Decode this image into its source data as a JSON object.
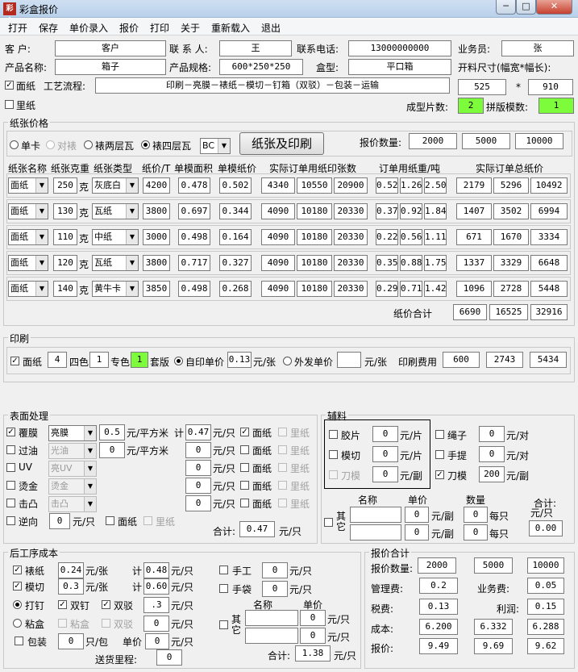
{
  "window": {
    "title": "彩盒报价",
    "app_icon": "彩盒",
    "controls": [
      "─",
      "□",
      "✕"
    ]
  },
  "menu": [
    "打开",
    "保存",
    "单价录入",
    "报价",
    "打印",
    "关于",
    "重新载入",
    "退出"
  ],
  "header": {
    "customer_label": "客    户:",
    "customer": "客户",
    "contact_label": "联 系 人:",
    "contact": "王",
    "phone_label": "联系电话:",
    "phone": "13000000000",
    "sales_label": "业务员:",
    "sales": "张",
    "product_label": "产品名称:",
    "product": "箱子",
    "spec_label": "产品规格:",
    "spec": "600*250*250",
    "boxtype_label": "盒型:",
    "boxtype": "平口箱",
    "opensize_label": "开料尺寸(幅宽*幅长):",
    "facepaper_label": "面纸",
    "process_label": "工艺流程:",
    "process": "印刷－亮膜－裱纸－模切－钉箱（双驳）－包装－运输",
    "w": "525",
    "star": "*",
    "h": "910",
    "inner_label": "里纸",
    "pieces_label": "成型片数:",
    "pieces": "2",
    "imposition_label": "拼版模数:",
    "imposition": "1"
  },
  "paper": {
    "group_title": "纸张价格",
    "radio": [
      "单卡",
      "对裱",
      "裱两层瓦",
      "裱四层瓦"
    ],
    "flute": "BC",
    "button": "纸张及印刷",
    "qty_label": "报价数量:",
    "qty": [
      "2000",
      "5000",
      "10000"
    ],
    "headers": [
      "纸张名称",
      "纸张克重",
      "纸张类型",
      "纸价/T",
      "单模面积",
      "单模纸价",
      "实际订单用纸印张数",
      "订单用纸重/吨",
      "实际订单总纸价"
    ],
    "unit": "克",
    "rows": [
      {
        "name": "面纸",
        "gsm": "250",
        "type": "灰底白",
        "price": "4200",
        "area": "0.478",
        "uprice": "0.502",
        "sheets": [
          "4340",
          "10550",
          "20900"
        ],
        "weight": [
          "0.52",
          "1.26",
          "2.50"
        ],
        "total": [
          "2179",
          "5296",
          "10492"
        ]
      },
      {
        "name": "面纸",
        "gsm": "130",
        "type": "瓦纸",
        "price": "3800",
        "area": "0.697",
        "uprice": "0.344",
        "sheets": [
          "4090",
          "10180",
          "20330"
        ],
        "weight": [
          "0.37",
          "0.92",
          "1.84"
        ],
        "total": [
          "1407",
          "3502",
          "6994"
        ]
      },
      {
        "name": "面纸",
        "gsm": "110",
        "type": "中纸",
        "price": "3000",
        "area": "0.498",
        "uprice": "0.164",
        "sheets": [
          "4090",
          "10180",
          "20330"
        ],
        "weight": [
          "0.22",
          "0.56",
          "1.11"
        ],
        "total": [
          "671",
          "1670",
          "3334"
        ]
      },
      {
        "name": "面纸",
        "gsm": "120",
        "type": "瓦纸",
        "price": "3800",
        "area": "0.717",
        "uprice": "0.327",
        "sheets": [
          "4090",
          "10180",
          "20330"
        ],
        "weight": [
          "0.35",
          "0.88",
          "1.75"
        ],
        "total": [
          "1337",
          "3329",
          "6648"
        ]
      },
      {
        "name": "面纸",
        "gsm": "140",
        "type": "黄牛卡",
        "price": "3850",
        "area": "0.498",
        "uprice": "0.268",
        "sheets": [
          "4090",
          "10180",
          "20330"
        ],
        "weight": [
          "0.29",
          "0.71",
          "1.42"
        ],
        "total": [
          "1096",
          "2728",
          "5448"
        ]
      }
    ],
    "sum_label": "纸价合计",
    "sum": [
      "6690",
      "16525",
      "32916"
    ]
  },
  "print": {
    "group_title": "印刷",
    "face_label": "面纸",
    "four": "4",
    "four_label": "四色",
    "spot": "1",
    "spot_label": "专色",
    "set": "1",
    "set_label": "套版",
    "self_label": "自印单价",
    "self": "0.13",
    "unit1": "元/张",
    "out_label": "外发单价",
    "out": "",
    "unit2": "元/张",
    "fee_label": "印刷费用",
    "fee": [
      "600",
      "2743",
      "5434"
    ]
  },
  "surface": {
    "group_title": "表面处理",
    "unit_sqm": "元/平方米",
    "ji": "计",
    "unit_pc": "元/只",
    "face": "面纸",
    "inner": "里纸",
    "rows": [
      {
        "label": "覆膜",
        "sel": "亮膜",
        "v1": "0.5",
        "v2": "0.47"
      },
      {
        "label": "过油",
        "sel": "光油",
        "v1": "0",
        "v2": "0"
      },
      {
        "label": "UV",
        "sel": "亮UV",
        "v2": "0"
      },
      {
        "label": "烫金",
        "sel": "烫金",
        "v2": "0"
      },
      {
        "label": "击凸",
        "sel": "击凸",
        "v2": "0"
      }
    ],
    "reverse_label": "逆向",
    "reverse": "0",
    "total_label": "合计:",
    "total": "0.47"
  },
  "aux": {
    "group_title": "辅料",
    "window_label": "胶片",
    "window": "0",
    "window_unit": "元/片",
    "die_label": "模切",
    "die": "0",
    "die_unit": "元/片",
    "knife_label": "刀模",
    "knife": "0",
    "knife_unit": "元/副",
    "rope_label": "绳子",
    "rope": "0",
    "rope_unit": "元/对",
    "handle_label": "手提",
    "handle": "0",
    "handle_unit": "元/对",
    "blade_label": "刀模",
    "blade": "200",
    "blade_unit": "元/副",
    "name_h": "名称",
    "price_h": "单价",
    "qty_h": "数量",
    "other_label": "其它",
    "other_unit": "元/副",
    "each": "每只",
    "p1": "0",
    "p2": "0",
    "q1": "0",
    "q2": "0",
    "total_label": "合计:\n元/只",
    "total_label1": "合计:",
    "total_label2": "元/只",
    "total": "0.00"
  },
  "post": {
    "group_title": "后工序成本",
    "mount_label": "裱纸",
    "mount": "0.24",
    "mount_unit": "元/张",
    "ji": "计",
    "mount_total": "0.48",
    "unit_pc": "元/只",
    "diecut_label": "模切",
    "diecut": "0.3",
    "diecut_total": "0.60",
    "hand_label": "手工",
    "hand": "0",
    "bag_label": "手袋",
    "bag": "0",
    "staple_label": "打钉",
    "double_nail": "双钉",
    "double_bo": "双驳",
    "staple": ".3",
    "glue_label": "粘盒",
    "glue_box": "粘盒",
    "glue_bo": "双驳",
    "glue": "0",
    "pack_label": "包装",
    "pack": "0",
    "pack_unit": "只/包",
    "unit_price": "单价",
    "pack_price": "0",
    "other_label": "其它",
    "name_h": "名称",
    "price_h": "单价",
    "o1": "0",
    "o2": "0",
    "total_label": "合计:",
    "total": "1.38",
    "mile_label": "送货里程:",
    "mile": "0"
  },
  "quote": {
    "group_title": "报价合计",
    "qty_label": "报价数量:",
    "qty": [
      "2000",
      "5000",
      "10000"
    ],
    "mgmt_label": "管理费:",
    "mgmt": "0.2",
    "biz_label": "业务费:",
    "biz": "0.05",
    "tax_label": "税费:",
    "tax": "0.13",
    "profit_label": "利润:",
    "profit": "0.15",
    "cost_label": "成本:",
    "cost": [
      "6.200",
      "6.332",
      "6.288"
    ],
    "price_label": "报价:",
    "price": [
      "9.49",
      "9.69",
      "9.62"
    ]
  }
}
